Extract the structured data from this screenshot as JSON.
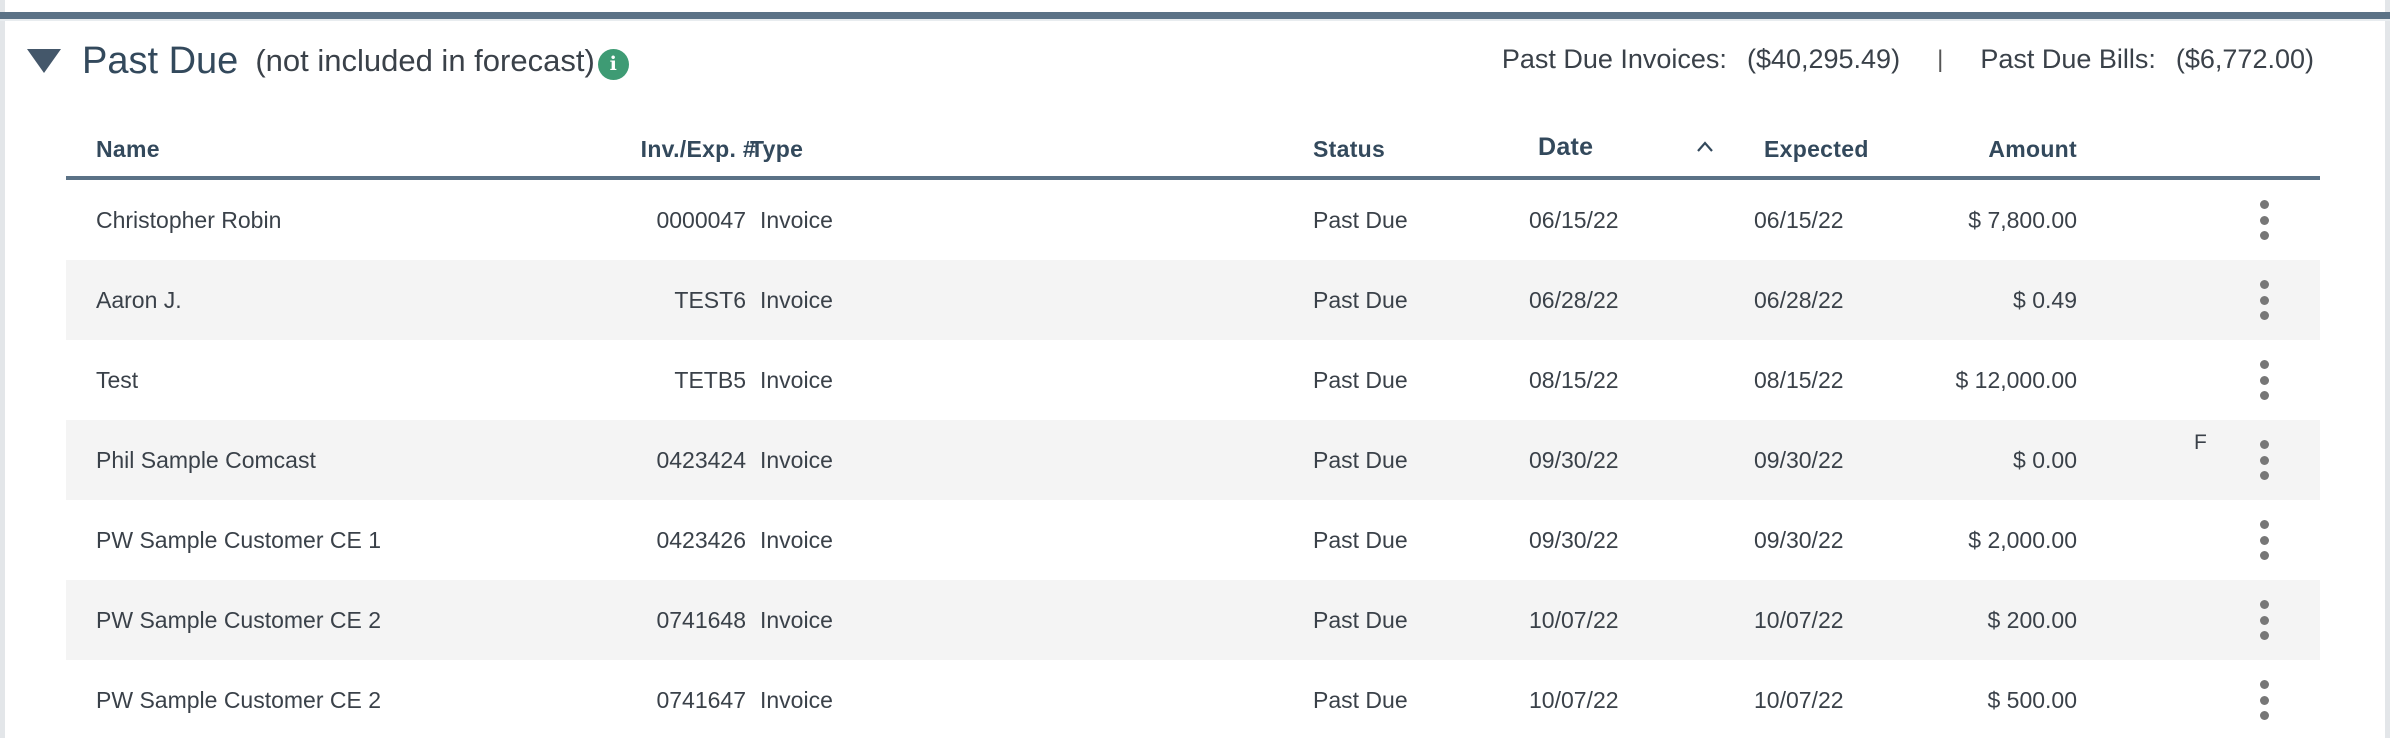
{
  "section": {
    "title": "Past Due",
    "subtitle": "(not included in forecast)",
    "info_glyph": "i"
  },
  "summary": {
    "invoices_label": "Past Due Invoices:",
    "invoices_value": "($40,295.49)",
    "separator": "|",
    "bills_label": "Past Due Bills:",
    "bills_value": "($6,772.00)"
  },
  "columns": {
    "name": "Name",
    "inv": "Inv./Exp. #",
    "type": "Type",
    "status": "Status",
    "date": "Date",
    "expected": "Expected",
    "amount": "Amount"
  },
  "sort": {
    "column": "date",
    "direction": "ascending"
  },
  "rows": [
    {
      "name": "Christopher Robin",
      "inv": "0000047",
      "type": "Invoice",
      "status": "Past Due",
      "date": "06/15/22",
      "expected": "06/15/22",
      "amount": "$ 7,800.00",
      "flag": ""
    },
    {
      "name": "Aaron J.",
      "inv": "TEST6",
      "type": "Invoice",
      "status": "Past Due",
      "date": "06/28/22",
      "expected": "06/28/22",
      "amount": "$ 0.49",
      "flag": ""
    },
    {
      "name": "Test",
      "inv": "TETB5",
      "type": "Invoice",
      "status": "Past Due",
      "date": "08/15/22",
      "expected": "08/15/22",
      "amount": "$ 12,000.00",
      "flag": ""
    },
    {
      "name": "Phil Sample Comcast",
      "inv": "0423424",
      "type": "Invoice",
      "status": "Past Due",
      "date": "09/30/22",
      "expected": "09/30/22",
      "amount": "$ 0.00",
      "flag": "F"
    },
    {
      "name": "PW Sample Customer CE 1",
      "inv": "0423426",
      "type": "Invoice",
      "status": "Past Due",
      "date": "09/30/22",
      "expected": "09/30/22",
      "amount": "$ 2,000.00",
      "flag": ""
    },
    {
      "name": "PW Sample Customer CE 2",
      "inv": "0741648",
      "type": "Invoice",
      "status": "Past Due",
      "date": "10/07/22",
      "expected": "10/07/22",
      "amount": "$ 200.00",
      "flag": ""
    },
    {
      "name": "PW Sample Customer CE 2",
      "inv": "0741647",
      "type": "Invoice",
      "status": "Past Due",
      "date": "10/07/22",
      "expected": "10/07/22",
      "amount": "$ 500.00",
      "flag": ""
    }
  ],
  "icons": {
    "collapse": "triangle-down-icon",
    "info": "info-icon",
    "sort": "chevron-up-icon",
    "row_menu": "kebab-menu-icon"
  },
  "colors": {
    "accent_bar": "#5b7286",
    "title": "#33495c",
    "info": "#3e9b74",
    "row_alt": "#f4f4f4"
  }
}
